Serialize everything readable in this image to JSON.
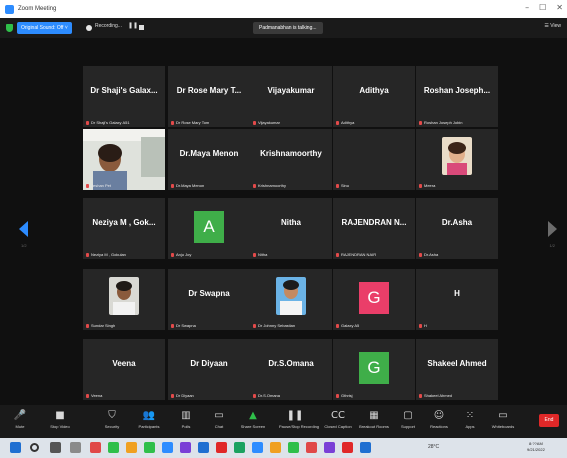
{
  "window": {
    "title": "Zoom Meeting",
    "controls": [
      "–",
      "☐",
      "✕"
    ]
  },
  "topbar": {
    "original_sound": "Original Sound: Off  ˅",
    "recording_label": "Recording...",
    "pause_glyph": "❚❚",
    "talking": "Padmanabhan is talking...",
    "view": "☰ View"
  },
  "grid": {
    "tiles": [
      {
        "name": "Dr Shaji's Galax...",
        "label": "Dr Shaji's Galaxy A51"
      },
      {
        "name": "Dr Rose Mary T...",
        "label": "Dr Rose Mary Tom"
      },
      {
        "name": "Vijayakumar",
        "label": "Vijayakumar"
      },
      {
        "name": "Adithya",
        "label": "Adithya"
      },
      {
        "name": "Roshan Joseph...",
        "label": "Roshan Joseph Jobin"
      },
      {
        "name": "",
        "label": "Jeshan Pet"
      },
      {
        "name": "Dr.Maya Menon",
        "label": "Dr.Maya Menon"
      },
      {
        "name": "Krishnamoorthy",
        "label": "Krishnamoorthy"
      },
      {
        "name": "",
        "label": "Sinu"
      },
      {
        "name": "",
        "label": "Meera"
      },
      {
        "name": "Neziya M , Gok...",
        "label": "Neziya M , Gokulan"
      },
      {
        "name": "",
        "label": "Anju Joy",
        "avatar": "A"
      },
      {
        "name": "Nitha",
        "label": "Nitha"
      },
      {
        "name": "RAJENDRAN N...",
        "label": "RAJENDRAN NAIR"
      },
      {
        "name": "Dr.Asha",
        "label": "Dr.Asha"
      },
      {
        "name": "",
        "label": "Sundar Singh"
      },
      {
        "name": "Dr Swapna",
        "label": "Dr Swapna"
      },
      {
        "name": "",
        "label": "Dr Johnny Sebastian"
      },
      {
        "name": "",
        "label": "Galaxy A5",
        "avatar": "G"
      },
      {
        "name": "H",
        "label": "H"
      },
      {
        "name": "Veena",
        "label": "Veena"
      },
      {
        "name": "Dr Diyaan",
        "label": "Dr Diyaan"
      },
      {
        "name": "Dr.S.Omana",
        "label": "Dr.S.Omana"
      },
      {
        "name": "",
        "label": "Gthrisj",
        "avatar": "G"
      },
      {
        "name": "Shakeel Ahmed",
        "label": "Shakeel Ahmed"
      }
    ]
  },
  "toolbar": {
    "items": [
      {
        "label": "Mute",
        "icon": "🎤"
      },
      {
        "label": "Stop Video",
        "icon": "■"
      },
      {
        "label": "Security",
        "icon": "⛉"
      },
      {
        "label": "Participants",
        "icon": "👥"
      },
      {
        "label": "Polls",
        "icon": "▥"
      },
      {
        "label": "Chat",
        "icon": "▭"
      },
      {
        "label": "Share Screen",
        "icon": "▲"
      },
      {
        "label": "Pause/Stop Recording",
        "icon": "❚❚"
      },
      {
        "label": "Closed Caption",
        "icon": "CC"
      },
      {
        "label": "Breakout Rooms",
        "icon": "▦"
      },
      {
        "label": "Support",
        "icon": "▢"
      },
      {
        "label": "Reactions",
        "icon": "☺"
      },
      {
        "label": "Apps",
        "icon": "⁙"
      },
      {
        "label": "Whiteboards",
        "icon": "▭"
      }
    ],
    "end": "End"
  },
  "taskbar": {
    "weather": "28°C",
    "time": "8:??AM",
    "date": "9/21/2022",
    "colors": [
      "#1f6fd1",
      "#e04848",
      "#2fbf4a",
      "#f0a020",
      "#2d8cff",
      "#7a3fd6",
      "#e02828",
      "#1aa260"
    ]
  },
  "colors": {
    "stage": "#101010",
    "tile": "#262626",
    "accent": "#2d8cff",
    "avatar_green": "#3fae49",
    "avatar_pink": "#ea3e69",
    "end": "#e02828"
  }
}
